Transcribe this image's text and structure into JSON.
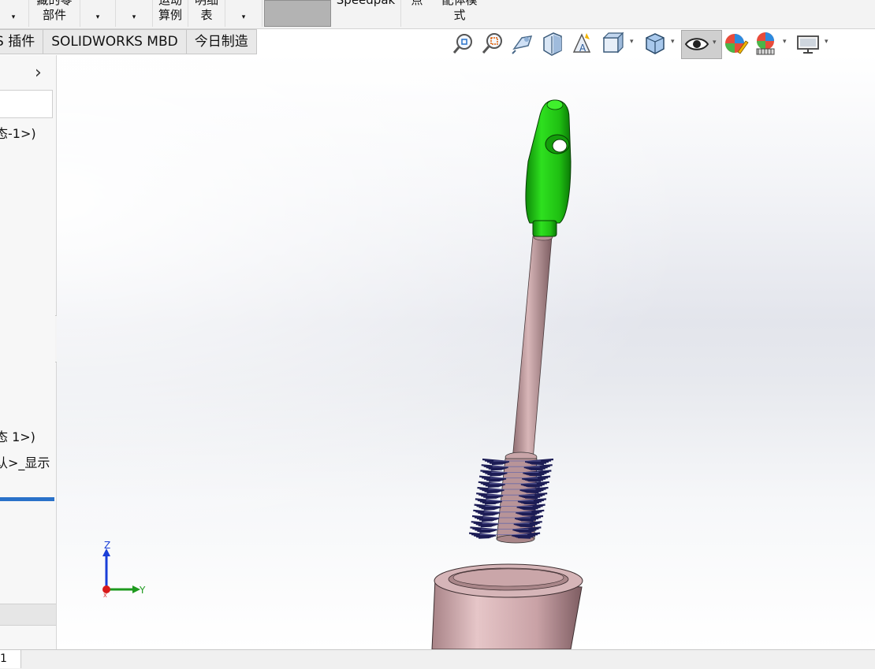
{
  "ribbon": {
    "b1_dd": "▾",
    "b2_line1": "藏的零",
    "b2_line2": "部件",
    "b3_dd": "▾",
    "b4_dd": "▾",
    "b5_line1": "运动",
    "b5_line2": "算例",
    "b6_line1": "明细",
    "b6_line2": "表",
    "b7_dd": "▾",
    "b8_line1": "Speedpak",
    "b9_line1": "点",
    "b10_line1": "配体模",
    "b10_line2": "式"
  },
  "tabs": [
    "S 插件",
    "SOLIDWORKS MBD",
    "今日制造"
  ],
  "left_panel": {
    "chevron": "›",
    "item1": "态-1>)",
    "item2": "态 1>)",
    "item3": "认>_显示"
  },
  "triad": {
    "z": "Z",
    "y": "Y",
    "x": "X"
  },
  "status": {
    "tab_text": "1"
  },
  "hud": {
    "icons": [
      "zoom-to-fit-icon",
      "zoom-to-area-icon",
      "previous-view-icon",
      "section-view-icon",
      "dynamic-annotation-view-icon",
      "view-orientation-icon",
      "display-style-icon",
      "hide-show-items-icon",
      "edit-appearance-icon",
      "apply-scene-icon",
      "view-settings-icon"
    ],
    "dropdown": "▾"
  },
  "colors": {
    "handle_green": "#1fbf12",
    "handle_pink": "#c9a3a5",
    "bristles": "#1c1c55",
    "cup": "#d4aeb1",
    "selected_tab_bar": "#2a72c9"
  }
}
